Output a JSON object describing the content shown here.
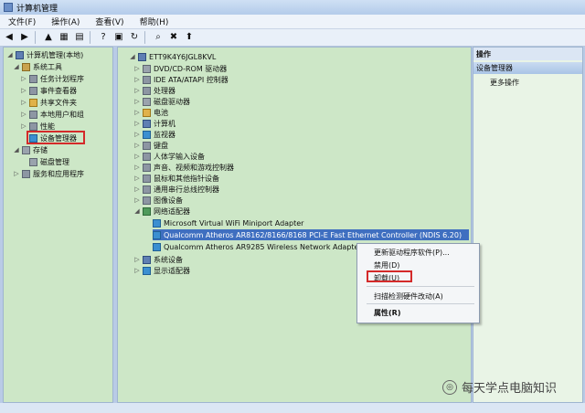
{
  "window": {
    "title": "计算机管理"
  },
  "menu": [
    "文件(F)",
    "操作(A)",
    "查看(V)",
    "帮助(H)"
  ],
  "left_tree": [
    {
      "label": "计算机管理(本地)",
      "icon": "computer-management-icon"
    },
    {
      "label": "系统工具",
      "icon": "tools-icon"
    },
    {
      "label": "任务计划程序",
      "icon": "clock-icon"
    },
    {
      "label": "事件查看器",
      "icon": "event-viewer-icon"
    },
    {
      "label": "共享文件夹",
      "icon": "shared-folder-icon"
    },
    {
      "label": "本地用户和组",
      "icon": "users-icon"
    },
    {
      "label": "性能",
      "icon": "performance-icon"
    },
    {
      "label": "设备管理器",
      "icon": "device-manager-icon"
    },
    {
      "label": "存储",
      "icon": "storage-icon"
    },
    {
      "label": "磁盘管理",
      "icon": "disk-icon"
    },
    {
      "label": "服务和应用程序",
      "icon": "services-icon"
    }
  ],
  "device_tree": {
    "root": "ETT9K4Y6JGL8KVL",
    "categories": [
      "DVD/CD-ROM 驱动器",
      "IDE ATA/ATAPI 控制器",
      "处理器",
      "磁盘驱动器",
      "电池",
      "计算机",
      "监视器",
      "键盘",
      "人体学输入设备",
      "声音、视频和游戏控制器",
      "鼠标和其他指针设备",
      "通用串行总线控制器",
      "图像设备",
      "网络适配器"
    ],
    "network_adapters": [
      "Microsoft Virtual WiFi Miniport Adapter",
      "Qualcomm Atheros AR8162/8166/8168 PCI-E Fast Ethernet Controller (NDIS 6.20)",
      "Qualcomm Atheros AR9285 Wireless Network Adapter"
    ],
    "after": [
      "系统设备",
      "显示适配器"
    ]
  },
  "right_pane": {
    "header": "操作",
    "section": "设备管理器",
    "action": "更多操作"
  },
  "context_menu": {
    "update": "更新驱动程序软件(P)...",
    "disable": "禁用(D)",
    "uninstall": "卸载(U)",
    "scan": "扫描检测硬件改动(A)",
    "properties": "属性(R)"
  },
  "watermark": "每天学点电脑知识",
  "colors": {
    "highlight": "#d42a2a",
    "pane_bg": "#cde7c7",
    "selection": "#3f6fc0"
  }
}
